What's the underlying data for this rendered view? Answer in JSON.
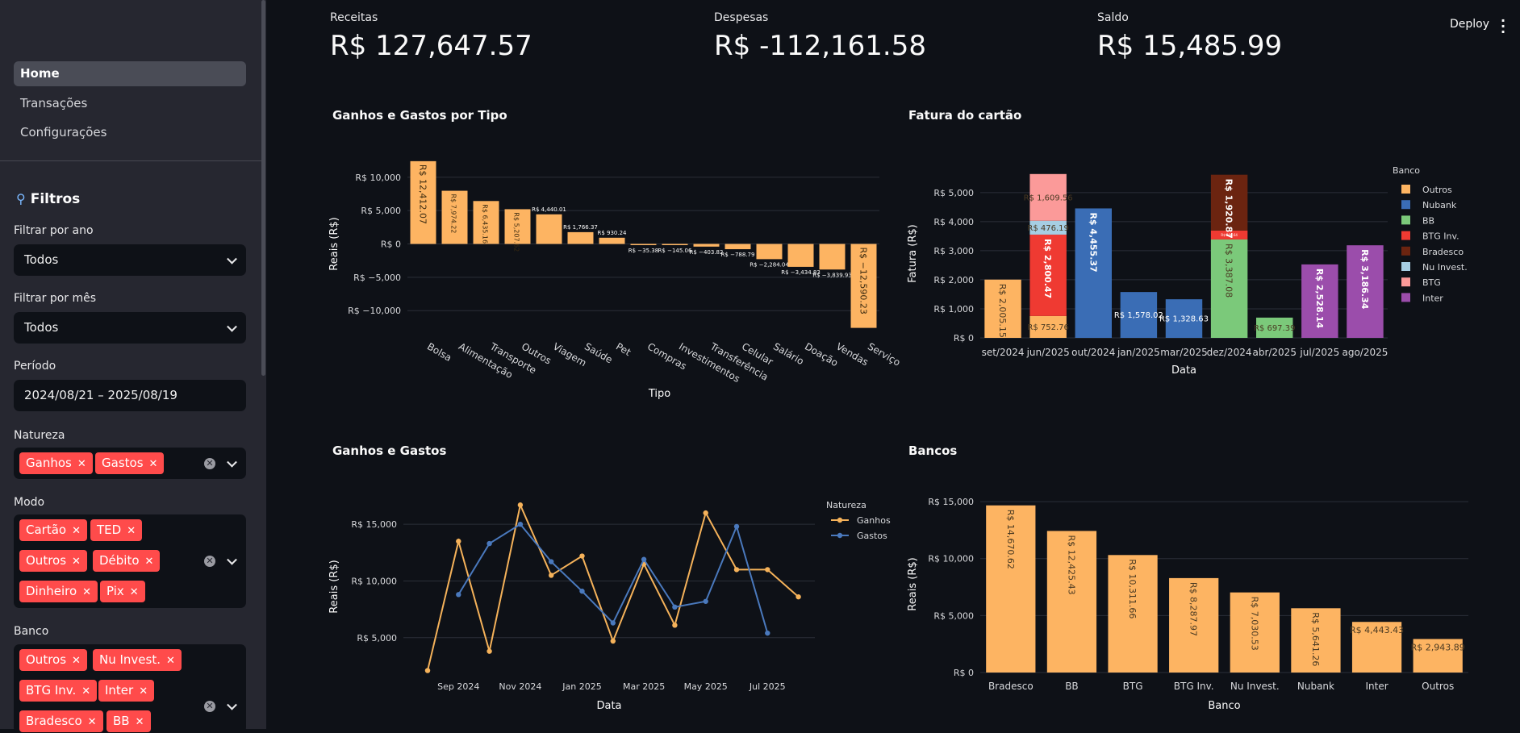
{
  "sidebar": {
    "nav": [
      {
        "label": "Home",
        "active": true
      },
      {
        "label": "Transações",
        "active": false
      },
      {
        "label": "Configurações",
        "active": false
      }
    ],
    "filters_icon": "magnifier-icon",
    "filters_title": "Filtros",
    "year": {
      "label": "Filtrar por ano",
      "value": "Todos"
    },
    "month": {
      "label": "Filtrar por mês",
      "value": "Todos"
    },
    "period": {
      "label": "Período",
      "value": "2024/08/21 – 2025/08/19"
    },
    "natureza": {
      "label": "Natureza",
      "tags": [
        "Ganhos",
        "Gastos"
      ]
    },
    "modo": {
      "label": "Modo",
      "tags": [
        "Cartão",
        "TED",
        "Outros",
        "Débito",
        "Dinheiro",
        "Pix"
      ]
    },
    "banco": {
      "label": "Banco",
      "tags": [
        "Outros",
        "Nu Invest.",
        "BTG Inv.",
        "Inter",
        "Bradesco",
        "BB"
      ]
    }
  },
  "header": {
    "deploy_label": "Deploy",
    "menu_icon": "kebab-menu-icon"
  },
  "metrics": [
    {
      "label": "Receitas",
      "value": "R$ 127,647.57"
    },
    {
      "label": "Despesas",
      "value": "R$ -112,161.58"
    },
    {
      "label": "Saldo",
      "value": "R$ 15,485.99"
    }
  ],
  "colors": {
    "orange": "#fdb462",
    "blue": "#3a6db5",
    "green": "#7bc97a",
    "red": "#ef3a32",
    "brown": "#6b2410",
    "lightblue": "#a6cee3",
    "pink": "#fb9a99",
    "purple": "#9b4dab",
    "line_orange": "#f5b25a",
    "line_blue": "#4a79bd"
  },
  "chart_data": [
    {
      "title": "Ganhos e Gastos por Tipo",
      "type": "bar",
      "xlabel": "Tipo",
      "ylabel": "Reais (R$)",
      "ylim": [
        -13000,
        13000
      ],
      "yticks": [
        {
          "v": 10000,
          "label": "R$ 10,000"
        },
        {
          "v": 5000,
          "label": "R$ 5,000"
        },
        {
          "v": 0,
          "label": "R$ 0"
        },
        {
          "v": -5000,
          "label": "R$ −5,000"
        },
        {
          "v": -10000,
          "label": "R$ −10,000"
        }
      ],
      "categories": [
        "Bolsa",
        "Alimentação",
        "Transporte",
        "Outros",
        "Viagem",
        "Saúde",
        "Pet",
        "Compras",
        "Investimentos",
        "Transferência",
        "Celular",
        "Salário",
        "Doação",
        "Vendas",
        "Serviço"
      ],
      "values": [
        12412.07,
        7974.22,
        6435.16,
        5207.62,
        4440.01,
        1766.37,
        930.24,
        -35.38,
        -145.06,
        -403.82,
        -788.79,
        -2284.04,
        -3434.83,
        -3839.93,
        -12590.23
      ],
      "labels": [
        "R$ 12,412.07",
        "R$ 7,974.22",
        "R$ 6,435.16",
        "R$ 5,207.62",
        "R$ 4,440.01",
        "R$ 1,766.37",
        "R$ 930.24",
        "R$ −35.38",
        "R$ −145.06",
        "R$ −403.82",
        "R$ −788.79",
        "R$ −2,284.04",
        "R$ −3,434.83",
        "R$ −3,839.93",
        "R$ −12,590.23"
      ],
      "grid": true
    },
    {
      "title": "Fatura do cartão",
      "type": "bar",
      "stacked": true,
      "xlabel": "Data",
      "ylabel": "Fatura (R$)",
      "ylim": [
        0,
        5800
      ],
      "yticks": [
        {
          "v": 5000,
          "label": "R$ 5,000"
        },
        {
          "v": 4000,
          "label": "R$ 4,000"
        },
        {
          "v": 3000,
          "label": "R$ 3,000"
        },
        {
          "v": 2000,
          "label": "R$ 2,000"
        },
        {
          "v": 1000,
          "label": "R$ 1,000"
        },
        {
          "v": 0,
          "label": "R$ 0"
        }
      ],
      "legend_title": "Banco",
      "legend_position": "right",
      "legend": [
        {
          "name": "Outros",
          "color": "#fdb462"
        },
        {
          "name": "Nubank",
          "color": "#3a6db5"
        },
        {
          "name": "BB",
          "color": "#7bc97a"
        },
        {
          "name": "BTG Inv.",
          "color": "#ef3a32"
        },
        {
          "name": "Bradesco",
          "color": "#6b2410"
        },
        {
          "name": "Nu Invest.",
          "color": "#a6cee3"
        },
        {
          "name": "BTG",
          "color": "#fb9a99"
        },
        {
          "name": "Inter",
          "color": "#9b4dab"
        }
      ],
      "categories": [
        "set/2024",
        "jun/2025",
        "out/2024",
        "jan/2025",
        "mar/2025",
        "dez/2024",
        "abr/2025",
        "jul/2025",
        "ago/2025"
      ],
      "stacks": [
        [
          {
            "series": "Outros",
            "value": 2005.15,
            "label": "R$ 2,005.15"
          }
        ],
        [
          {
            "series": "Outros",
            "value": 752.76,
            "label": "R$ 752.76"
          },
          {
            "series": "BTG Inv.",
            "value": 2800.47,
            "label": "R$ 2,800.47"
          },
          {
            "series": "Nu Invest.",
            "value": 476.19,
            "label": "R$ 476.19"
          },
          {
            "series": "BTG",
            "value": 1609.56,
            "label": "R$ 1,609.56"
          }
        ],
        [
          {
            "series": "Nubank",
            "value": 4455.37,
            "label": "R$ 4,455.37"
          }
        ],
        [
          {
            "series": "Nubank",
            "value": 1578.02,
            "label": "R$ 1,578.02"
          }
        ],
        [
          {
            "series": "Nubank",
            "value": 1328.63,
            "label": "R$ 1,328.63"
          }
        ],
        [
          {
            "series": "BB",
            "value": 3387.08,
            "label": "R$ 3,387.08"
          },
          {
            "series": "BTG Inv.",
            "value": 306.64,
            "label": "R$ 306.64"
          },
          {
            "series": "Bradesco",
            "value": 1920.87,
            "label": "R$ 1,920.87"
          }
        ],
        [
          {
            "series": "BB",
            "value": 697.39,
            "label": "R$ 697.39"
          }
        ],
        [
          {
            "series": "Inter",
            "value": 2528.14,
            "label": "R$ 2,528.14"
          }
        ],
        [
          {
            "series": "Inter",
            "value": 3186.34,
            "label": "R$ 3,186.34"
          }
        ]
      ],
      "grid": true
    },
    {
      "title": "Ganhos e Gastos",
      "type": "line",
      "xlabel": "Data",
      "ylabel": "Reais (R$)",
      "ylim": [
        1500,
        17500
      ],
      "yticks": [
        {
          "v": 15000,
          "label": "R$ 15,000"
        },
        {
          "v": 10000,
          "label": "R$ 10,000"
        },
        {
          "v": 5000,
          "label": "R$ 5,000"
        }
      ],
      "xticks": [
        "Sep 2024",
        "Nov 2024",
        "Jan 2025",
        "Mar 2025",
        "May 2025",
        "Jul 2025"
      ],
      "legend_title": "Natureza",
      "legend_position": "right",
      "series": [
        {
          "name": "Ganhos",
          "color": "#f5b25a",
          "x": [
            "2024-08",
            "2024-09",
            "2024-10",
            "2024-11",
            "2024-12",
            "2025-01",
            "2025-02",
            "2025-03",
            "2025-04",
            "2025-05",
            "2025-06",
            "2025-07",
            "2025-08"
          ],
          "y": [
            2100,
            13500,
            3800,
            16700,
            10500,
            12200,
            4700,
            11500,
            6100,
            16000,
            11000,
            11000,
            8600
          ]
        },
        {
          "name": "Gastos",
          "color": "#4a79bd",
          "x": [
            "2024-09",
            "2024-10",
            "2024-11",
            "2024-12",
            "2025-01",
            "2025-02",
            "2025-03",
            "2025-04",
            "2025-05",
            "2025-06",
            "2025-07"
          ],
          "y": [
            8800,
            13300,
            15000,
            11700,
            9100,
            6300,
            11900,
            7700,
            8200,
            14800,
            5400
          ]
        }
      ],
      "grid": true
    },
    {
      "title": "Bancos",
      "type": "bar",
      "xlabel": "Banco",
      "ylabel": "Reais (R$)",
      "ylim": [
        0,
        15500
      ],
      "yticks": [
        {
          "v": 15000,
          "label": "R$ 15,000"
        },
        {
          "v": 10000,
          "label": "R$ 10,000"
        },
        {
          "v": 5000,
          "label": "R$ 5,000"
        },
        {
          "v": 0,
          "label": "R$ 0"
        }
      ],
      "categories": [
        "Bradesco",
        "BB",
        "BTG",
        "BTG Inv.",
        "Nu Invest.",
        "Nubank",
        "Inter",
        "Outros"
      ],
      "values": [
        14670.62,
        12425.43,
        10311.66,
        8287.97,
        7030.53,
        5641.26,
        4443.43,
        2943.89
      ],
      "labels": [
        "R$ 14,670.62",
        "R$ 12,425.43",
        "R$ 10,311.66",
        "R$ 8,287.97",
        "R$ 7,030.53",
        "R$ 5,641.26",
        "R$ 4,443.43",
        "R$ 2,943.89"
      ],
      "grid": true
    }
  ]
}
